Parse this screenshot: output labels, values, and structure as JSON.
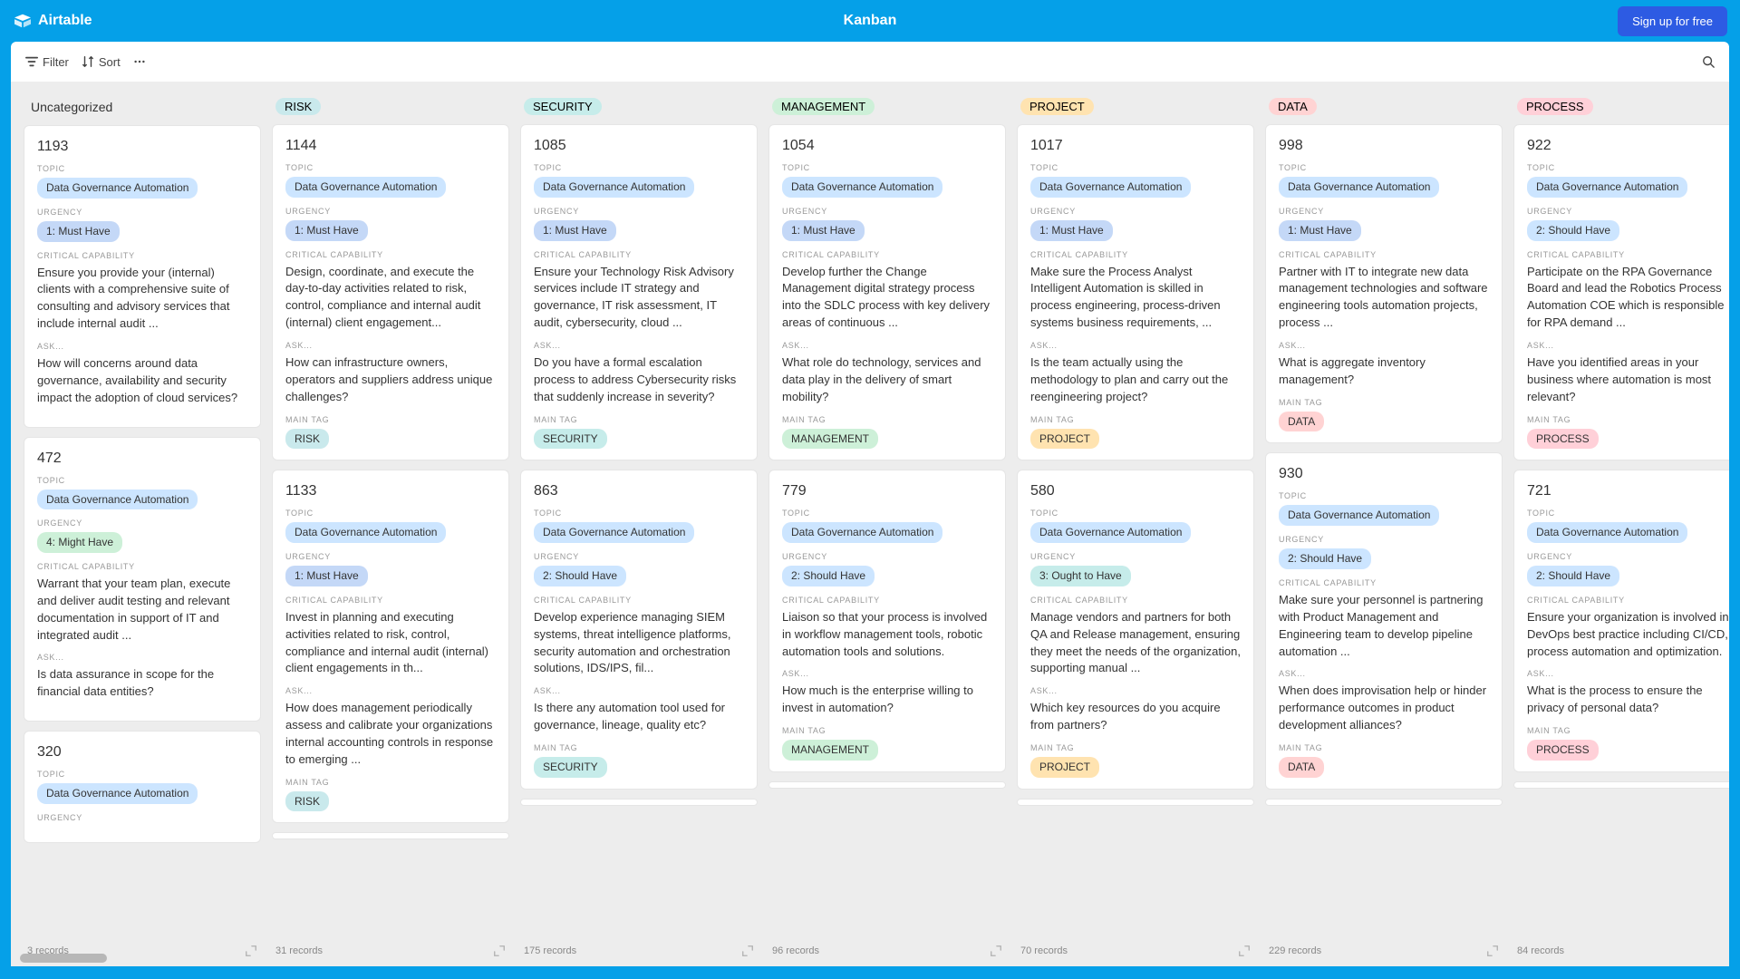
{
  "header": {
    "brand": "Airtable",
    "view_title": "Kanban",
    "signup": "Sign up for free"
  },
  "toolbar": {
    "filter": "Filter",
    "sort": "Sort"
  },
  "labels": {
    "topic": "TOPIC",
    "urgency": "URGENCY",
    "critical": "CRITICAL CAPABILITY",
    "ask": "ASK...",
    "main_tag": "MAIN TAG"
  },
  "columns": [
    {
      "title": "Uncategorized",
      "plain": true,
      "footer": "3 records",
      "cards": [
        {
          "id": "1193",
          "topic": "Data Governance Automation",
          "topic_c": "c-blueL",
          "urgency": "1: Must Have",
          "urgency_c": "c-blue2",
          "critical": "Ensure you provide your (internal) clients with a comprehensive suite of consulting and advisory services that include internal audit ...",
          "ask": "How will concerns around data governance, availability and security impact the adoption of cloud services?"
        },
        {
          "id": "472",
          "topic": "Data Governance Automation",
          "topic_c": "c-blueL",
          "urgency": "4: Might Have",
          "urgency_c": "c-green",
          "critical": "Warrant that your team plan, execute and deliver audit testing and relevant documentation in support of IT and integrated audit ...",
          "ask": "Is data assurance in scope for the financial data entities?"
        },
        {
          "id": "320",
          "topic": "Data Governance Automation",
          "topic_c": "c-blueL",
          "urgency_label_only": true
        }
      ]
    },
    {
      "title": "RISK",
      "title_c": "c-cyan",
      "footer": "31 records",
      "cards": [
        {
          "id": "1144",
          "topic": "Data Governance Automation",
          "topic_c": "c-blueL",
          "urgency": "1: Must Have",
          "urgency_c": "c-blue2",
          "critical": "Design, coordinate, and execute the day-to-day activities related to risk, control, compliance and internal audit (internal) client engagement...",
          "ask": "How can infrastructure owners, operators and suppliers address unique challenges?",
          "main_tag": "RISK",
          "main_tag_c": "c-cyan"
        },
        {
          "id": "1133",
          "topic": "Data Governance Automation",
          "topic_c": "c-blueL",
          "urgency": "1: Must Have",
          "urgency_c": "c-blue2",
          "critical": "Invest in planning and executing activities related to risk, control, compliance and internal audit (internal) client engagements in th...",
          "ask": "How does management periodically assess and calibrate your organizations internal accounting controls in response to emerging ...",
          "main_tag": "RISK",
          "main_tag_c": "c-cyan"
        }
      ]
    },
    {
      "title": "SECURITY",
      "title_c": "c-teal",
      "footer": "175 records",
      "cards": [
        {
          "id": "1085",
          "topic": "Data Governance Automation",
          "topic_c": "c-blueL",
          "urgency": "1: Must Have",
          "urgency_c": "c-blue2",
          "critical": "Ensure your Technology Risk Advisory services include IT strategy and governance, IT risk assessment, IT audit, cybersecurity, cloud ...",
          "ask": "Do you have a formal escalation process to address Cybersecurity risks that suddenly increase in severity?",
          "main_tag": "SECURITY",
          "main_tag_c": "c-teal"
        },
        {
          "id": "863",
          "topic": "Data Governance Automation",
          "topic_c": "c-blueL",
          "urgency": "2: Should Have",
          "urgency_c": "c-blueL",
          "critical": "Develop experience managing SIEM systems, threat intelligence platforms, security automation and orchestration solutions, IDS/IPS, fil...",
          "ask": "Is there any automation tool used for governance, lineage, quality etc?",
          "main_tag": "SECURITY",
          "main_tag_c": "c-teal"
        }
      ]
    },
    {
      "title": "MANAGEMENT",
      "title_c": "c-green",
      "footer": "96 records",
      "cards": [
        {
          "id": "1054",
          "topic": "Data Governance Automation",
          "topic_c": "c-blueL",
          "urgency": "1: Must Have",
          "urgency_c": "c-blue2",
          "critical": "Develop further the Change Management digital strategy process into the SDLC process with key delivery areas of continuous ...",
          "ask": "What role do technology, services and data play in the delivery of smart mobility?",
          "main_tag": "MANAGEMENT",
          "main_tag_c": "c-green"
        },
        {
          "id": "779",
          "topic": "Data Governance Automation",
          "topic_c": "c-blueL",
          "urgency": "2: Should Have",
          "urgency_c": "c-blueL",
          "critical": "Liaison so that your process is involved in workflow management tools, robotic automation tools and solutions.",
          "ask": "How much is the enterprise willing to invest in automation?",
          "main_tag": "MANAGEMENT",
          "main_tag_c": "c-green"
        }
      ]
    },
    {
      "title": "PROJECT",
      "title_c": "c-yellow",
      "footer": "70 records",
      "cards": [
        {
          "id": "1017",
          "topic": "Data Governance Automation",
          "topic_c": "c-blueL",
          "urgency": "1: Must Have",
          "urgency_c": "c-blue2",
          "critical": "Make sure the Process Analyst Intelligent Automation is skilled in process engineering, process-driven systems business requirements, ...",
          "ask": "Is the team actually using the methodology to plan and carry out the reengineering project?",
          "main_tag": "PROJECT",
          "main_tag_c": "c-yellow"
        },
        {
          "id": "580",
          "topic": "Data Governance Automation",
          "topic_c": "c-blueL",
          "urgency": "3: Ought to Have",
          "urgency_c": "c-teal",
          "critical": "Manage vendors and partners for both QA and Release management, ensuring they meet the needs of the organization, supporting manual ...",
          "ask": "Which key resources do you acquire from partners?",
          "main_tag": "PROJECT",
          "main_tag_c": "c-yellow"
        }
      ]
    },
    {
      "title": "DATA",
      "title_c": "c-red",
      "footer": "229 records",
      "cards": [
        {
          "id": "998",
          "topic": "Data Governance Automation",
          "topic_c": "c-blueL",
          "urgency": "1: Must Have",
          "urgency_c": "c-blue2",
          "critical": "Partner with IT to integrate new data management technologies and software engineering tools automation projects, process ...",
          "ask": "What is aggregate inventory management?",
          "main_tag": "DATA",
          "main_tag_c": "c-red"
        },
        {
          "id": "930",
          "topic": "Data Governance Automation",
          "topic_c": "c-blueL",
          "urgency": "2: Should Have",
          "urgency_c": "c-blueL",
          "critical": "Make sure your personnel is partnering with Product Management and Engineering team to develop pipeline automation ...",
          "ask": "When does improvisation help or hinder performance outcomes in product development alliances?",
          "main_tag": "DATA",
          "main_tag_c": "c-red"
        }
      ]
    },
    {
      "title": "PROCESS",
      "title_c": "c-pink",
      "footer": "84 records",
      "cards": [
        {
          "id": "922",
          "topic": "Data Governance Automation",
          "topic_c": "c-blueL",
          "urgency": "2: Should Have",
          "urgency_c": "c-blueL",
          "critical": "Participate on the RPA Governance Board and lead the Robotics Process Automation COE which is responsible for RPA demand ...",
          "ask": "Have you identified areas in your business where automation is most relevant?",
          "main_tag": "PROCESS",
          "main_tag_c": "c-pink"
        },
        {
          "id": "721",
          "topic": "Data Governance Automation",
          "topic_c": "c-blueL",
          "urgency": "2: Should Have",
          "urgency_c": "c-blueL",
          "critical": "Ensure your organization is involved in DevOps best practice including CI/CD, process automation and optimization.",
          "ask": "What is the process to ensure the privacy of personal data?",
          "main_tag": "PROCESS",
          "main_tag_c": "c-pink"
        }
      ]
    }
  ]
}
